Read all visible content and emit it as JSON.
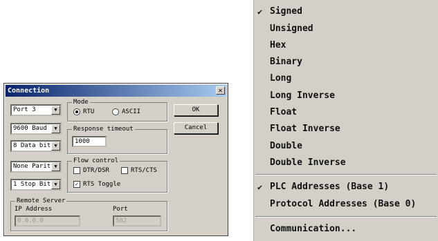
{
  "dialog": {
    "title": "Connection",
    "close_glyph": "✕",
    "port": "Port 3",
    "baud": "9600 Baud",
    "data_bits": "8 Data bits",
    "parity": "None Parity",
    "stop_bit": "1 Stop Bit",
    "arrow_glyph": "▼",
    "mode": {
      "label": "Mode",
      "rtu": "RTU",
      "ascii": "ASCII",
      "selected": "RTU"
    },
    "response_timeout": {
      "label": "Response timeout",
      "value": "1000"
    },
    "flow_control": {
      "label": "Flow control",
      "dtr_dsr": "DTR/DSR",
      "dtr_dsr_checked": false,
      "rts_cts": "RTS/CTS",
      "rts_cts_checked": false,
      "rts_toggle": "RTS Toggle",
      "rts_toggle_checked": true,
      "check_glyph": "✓"
    },
    "remote_server": {
      "label": "Remote Server",
      "ip_label": "IP Address",
      "ip_value": "0.0.0.0",
      "port_label": "Port",
      "port_value": "502"
    },
    "ok_label": "OK",
    "cancel_label": "Cancel"
  },
  "menu": {
    "tick_glyph": "✔",
    "items": [
      {
        "label": "Signed",
        "checked": true
      },
      {
        "label": "Unsigned",
        "checked": false
      },
      {
        "label": "Hex",
        "checked": false
      },
      {
        "label": "Binary",
        "checked": false
      },
      {
        "label": "Long",
        "checked": false
      },
      {
        "label": "Long Inverse",
        "checked": false
      },
      {
        "label": "Float",
        "checked": false
      },
      {
        "label": "Float Inverse",
        "checked": false
      },
      {
        "label": "Double",
        "checked": false
      },
      {
        "label": "Double Inverse",
        "checked": false
      }
    ],
    "address_items": [
      {
        "label": "PLC Addresses (Base 1)",
        "checked": true
      },
      {
        "label": "Protocol Addresses (Base 0)",
        "checked": false
      }
    ],
    "communication": "Communication..."
  }
}
